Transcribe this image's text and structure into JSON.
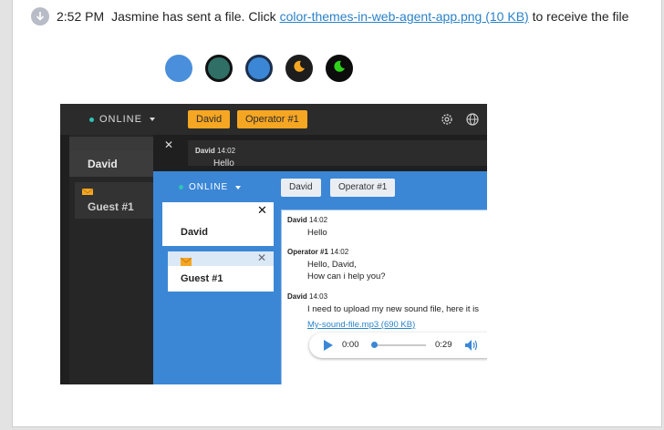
{
  "message": {
    "time": "2:52 PM",
    "text_before": "Jasmine has sent a file. Click",
    "file_link": "color-themes-in-web-agent-app.png (10 KB)",
    "text_after": "to receive the file"
  },
  "colors": {
    "background": "#e3e3e3",
    "link": "#2a82c9",
    "accent_blue": "#3b87d6",
    "accent_orange": "#f5a623",
    "online_dot": "#2ec4b6"
  },
  "swatches": [
    {
      "name": "blue",
      "fill": "#4a8fdb",
      "ring": "#4a8fdb",
      "icon": ""
    },
    {
      "name": "teal",
      "fill": "#2f6f66",
      "ring": "#111111",
      "icon": ""
    },
    {
      "name": "blue-dark-ring",
      "fill": "#3b87d6",
      "ring": "#1b2f4d",
      "icon": ""
    },
    {
      "name": "dark-orange-moon",
      "fill": "#1d1d1d",
      "ring": "#1d1d1d",
      "icon": "moon-icon",
      "icon_color": "#f5a623"
    },
    {
      "name": "dark-green-moon",
      "fill": "#0c0c0c",
      "ring": "#0c0c0c",
      "icon": "moon-icon",
      "icon_color": "#2fd11b"
    }
  ],
  "preview": {
    "dark": {
      "status": "ONLINE",
      "tabs": [
        "David",
        "Operator #1"
      ],
      "contacts": [
        "David",
        "Guest #1"
      ],
      "msg_author": "David",
      "msg_time": "14:02",
      "msg_text": "Hello"
    },
    "light": {
      "status": "ONLINE",
      "tabs": [
        "David",
        "Operator #1"
      ],
      "contacts": [
        "David",
        "Guest #1"
      ],
      "messages": [
        {
          "author": "David",
          "time": "14:02",
          "lines": [
            "Hello"
          ]
        },
        {
          "author": "Operator #1",
          "time": "14:02",
          "lines": [
            "Hello, David,",
            "How can i help you?"
          ]
        },
        {
          "author": "David",
          "time": "14:03",
          "lines": [
            "I need to upload my new sound file, here it is"
          ]
        }
      ],
      "attachment": "My-sound-file.mp3 (690 KB)",
      "player": {
        "current": "0:00",
        "duration": "0:29",
        "progress": 0.0
      }
    }
  }
}
